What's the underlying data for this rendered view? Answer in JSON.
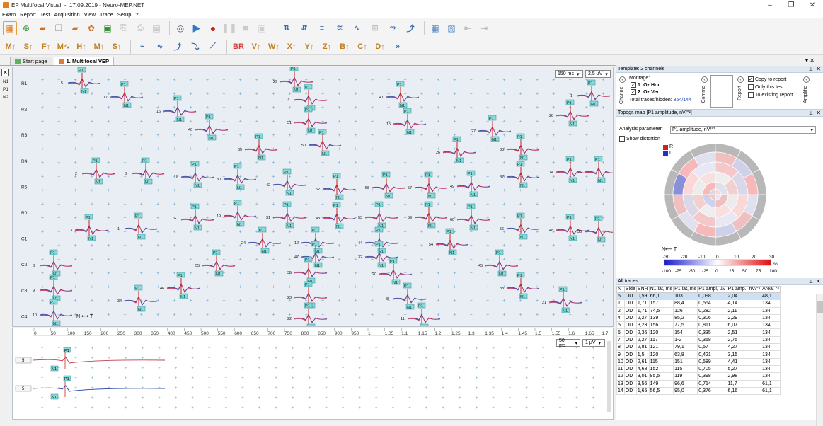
{
  "window": {
    "title": "EP Multifocal Visual, -, 17.09.2019 - Neuro-MEP.NET",
    "minimize": "–",
    "maximize": "❐",
    "close": "✕"
  },
  "menu": [
    "Exam",
    "Report",
    "Test",
    "Acquisition",
    "View",
    "Trace",
    "Setup",
    "?"
  ],
  "tabs": [
    {
      "label": "Start page"
    },
    {
      "label": "1. Multifocal VEP"
    }
  ],
  "left_strip": {
    "close": "✕",
    "items": [
      "N1",
      "P1",
      "N2"
    ]
  },
  "mf": {
    "time_select": "150 ms",
    "amp_select": "2.5 µV",
    "nt_label": "N ⟷ T",
    "row_labels": [
      "R1",
      "R2",
      "R3",
      "R4",
      "R5",
      "R0",
      "C1",
      "C2",
      "C3",
      "C4"
    ],
    "peaks": [
      {
        "n": "5",
        "p": "P1",
        "q": "N1"
      },
      {
        "n": "1",
        "p": "P1",
        "q": "N1"
      },
      {
        "n": "17",
        "p": "P1",
        "q": "N1"
      },
      {
        "n": "29",
        "p": "P1",
        "q": "N1"
      },
      {
        "n": "41",
        "p": "P1",
        "q": "N1"
      },
      {
        "n": "4",
        "p": "P1",
        "q": "N1"
      },
      {
        "n": "16",
        "p": "P1",
        "q": "N1"
      },
      {
        "n": "28",
        "p": "P1",
        "q": "N1"
      },
      {
        "n": "40",
        "p": "P1",
        "q": "N1"
      },
      {
        "n": "51",
        "p": "P1",
        "q": "N1"
      },
      {
        "n": "15",
        "p": "P1",
        "q": "N1"
      },
      {
        "n": "27",
        "p": "P1",
        "q": "N1"
      },
      {
        "n": "39",
        "p": "P1",
        "q": "N1"
      },
      {
        "n": "50",
        "p": "P1",
        "q": "N1"
      },
      {
        "n": "26",
        "p": "P1",
        "q": "N1"
      },
      {
        "n": "38",
        "p": "P1",
        "q": "N1"
      },
      {
        "n": "14",
        "p": "P1",
        "q": "N1"
      },
      {
        "n": "2",
        "p": "P1",
        "q": "N1"
      },
      {
        "n": "6",
        "p": "P1",
        "q": "N1"
      },
      {
        "n": "18",
        "p": "P1",
        "q": "N1"
      },
      {
        "n": "30",
        "p": "P1",
        "q": "N1"
      },
      {
        "n": "42",
        "p": "P1",
        "q": "N1"
      },
      {
        "n": "52",
        "p": "P1",
        "q": "N1"
      },
      {
        "n": "58",
        "p": "P1",
        "q": "N1"
      },
      {
        "n": "57",
        "p": "P1",
        "q": "N1"
      },
      {
        "n": "49",
        "p": "P1",
        "q": "N1"
      },
      {
        "n": "37",
        "p": "P1",
        "q": "N1"
      },
      {
        "n": "25",
        "p": "P1",
        "q": "N1"
      },
      {
        "n": "13",
        "p": "P1",
        "q": "N1"
      },
      {
        "n": "1",
        "p": "P1",
        "q": "N1"
      },
      {
        "n": "7",
        "p": "P1",
        "q": "N1"
      },
      {
        "n": "19",
        "p": "P1",
        "q": "N1"
      },
      {
        "n": "31",
        "p": "P1",
        "q": "N1"
      },
      {
        "n": "43",
        "p": "P1",
        "q": "N1"
      },
      {
        "n": "53",
        "p": "P1",
        "q": "N1"
      },
      {
        "n": "59",
        "p": "P1",
        "q": "N1"
      },
      {
        "n": "60",
        "p": "P1",
        "q": "N1"
      },
      {
        "n": "56",
        "p": "P1",
        "q": "N1"
      },
      {
        "n": "48",
        "p": "P1",
        "q": "N1"
      },
      {
        "n": "36",
        "p": "P1",
        "q": "N1"
      },
      {
        "n": "24",
        "p": "P1",
        "q": "N1"
      },
      {
        "n": "12",
        "p": "P1",
        "q": "N1"
      },
      {
        "n": "44",
        "p": "P1",
        "q": "N1"
      },
      {
        "n": "54",
        "p": "P1",
        "q": "N1"
      },
      {
        "n": "55",
        "p": "P1",
        "q": "N1"
      },
      {
        "n": "47",
        "p": "P1",
        "q": "N1"
      },
      {
        "n": "32",
        "p": "P1",
        "q": "N1"
      },
      {
        "n": "45",
        "p": "P1",
        "q": "N1"
      },
      {
        "n": "46",
        "p": "P1",
        "q": "N1"
      },
      {
        "n": "35",
        "p": "P1",
        "q": "N1"
      },
      {
        "n": "20",
        "p": "P1",
        "q": "N1"
      },
      {
        "n": "33",
        "p": "P1",
        "q": "N1"
      },
      {
        "n": "34",
        "p": "P1",
        "q": "N1"
      },
      {
        "n": "23",
        "p": "P1",
        "q": "N1"
      },
      {
        "n": "8",
        "p": "P1",
        "q": "N1"
      },
      {
        "n": "21",
        "p": "P1",
        "q": "N1"
      },
      {
        "n": "22",
        "p": "P1",
        "q": "N1"
      },
      {
        "n": "11",
        "p": "P1",
        "q": "N1"
      },
      {
        "n": "9",
        "p": "P1",
        "q": "N1"
      },
      {
        "n": "10",
        "p": "P1",
        "q": "N1"
      },
      {
        "n": "3",
        "p": "P1",
        "q": "N1"
      }
    ]
  },
  "lower": {
    "ruler": [
      "0",
      "50",
      "100",
      "150",
      "200",
      "250",
      "300",
      "350",
      "400",
      "450",
      "500",
      "550",
      "600",
      "650",
      "700",
      "750",
      "800",
      "850",
      "900",
      "950",
      "1",
      "1,05",
      "1,1",
      "1,15",
      "1,2",
      "1,25",
      "1,3",
      "1,35",
      "1,4",
      "1,45",
      "1,5",
      "1,55",
      "1,6",
      "1,65",
      "1,7"
    ],
    "time_select": "50 ms",
    "amp_select": "1 µV",
    "trace_labels": [
      "5",
      "5"
    ],
    "peaks": [
      "P1",
      "N1",
      "P1",
      "N1"
    ]
  },
  "template": {
    "header": "Template: 2 channels",
    "channel_label": "Channel",
    "montage_label": "Montage:",
    "ch1": "1: Oz Hor",
    "ch2": "2: Oz Ver",
    "total_label": "Total traces/hidden:",
    "total_value": "354/144",
    "comment_label": "Comme",
    "report_label": "Report",
    "copy": "Copy to report",
    "only": "Only this test",
    "existing": "To existing report",
    "amplifier_label": "Amplifie",
    "nav_prev": "‹",
    "nav_next": "›",
    "pin": "⊥",
    "close": "✕"
  },
  "topo": {
    "header": "Topogr. map [P1 amplitude, nV/°²]",
    "analysis_label": "Analysis parameter:",
    "analysis_value": "P1 amplitude, nV/°²",
    "show_distortion": "Show distortion",
    "legend_r": "R",
    "legend_l": "L",
    "nt": "N⟵ T",
    "scale_top": [
      "-30",
      "-20",
      "-10",
      "0",
      "10",
      "20",
      "30"
    ],
    "scale_bottom": [
      "-100",
      "-75",
      "-50",
      "-25",
      "0",
      "25",
      "50",
      "75",
      "100"
    ],
    "unit": "%",
    "pin": "⊥",
    "close": "✕"
  },
  "traces": {
    "header": "All traces",
    "columns": [
      "N",
      "Side",
      "SNR",
      "N1 lat, ms",
      "P1 lat, ms",
      "P1 ampl, µV",
      "P1 amp., nV/°²",
      "Area, °²"
    ],
    "rows": [
      [
        "5",
        "OD",
        "0,59",
        "66,1",
        "103",
        "0,098",
        "2,04",
        "48,1"
      ],
      [
        "1",
        "OD",
        "1,71",
        "157",
        "88,4",
        "0,554",
        "4,14",
        "134"
      ],
      [
        "2",
        "OD",
        "1,71",
        "74,5",
        "126",
        "0,282",
        "2,11",
        "134"
      ],
      [
        "4",
        "OD",
        "2,27",
        "139",
        "85,2",
        "0,306",
        "2,29",
        "134"
      ],
      [
        "5",
        "OD",
        "3,23",
        "156",
        "77,5",
        "0,811",
        "6,07",
        "134"
      ],
      [
        "6",
        "OD",
        "2,36",
        "120",
        "154",
        "0,335",
        "2,51",
        "134"
      ],
      [
        "7",
        "OD",
        "2,27",
        "117",
        "1-2",
        "0,368",
        "2,75",
        "134"
      ],
      [
        "8",
        "OD",
        "2,81",
        "121",
        "79,1",
        "0,57",
        "4,27",
        "134"
      ],
      [
        "9",
        "OD",
        "1,5",
        "120",
        "63,8",
        "0,421",
        "3,15",
        "134"
      ],
      [
        "10",
        "OD",
        "2,61",
        "115",
        "151",
        "0,589",
        "4,41",
        "134"
      ],
      [
        "11",
        "OD",
        "4,68",
        "152",
        "115",
        "0,705",
        "5,27",
        "134"
      ],
      [
        "12",
        "OD",
        "3,01",
        "85,5",
        "119",
        "0,398",
        "2,98",
        "134"
      ],
      [
        "13",
        "OD",
        "3,56",
        "149",
        "96,6",
        "0,714",
        "11,7",
        "61,1"
      ],
      [
        "14",
        "OD",
        "1,65",
        "56,5",
        "95,0",
        "0,376",
        "6,16",
        "61,1"
      ]
    ],
    "pin": "⊥",
    "close": "✕"
  },
  "toolbar": {
    "close_all": "▾ ✕"
  }
}
